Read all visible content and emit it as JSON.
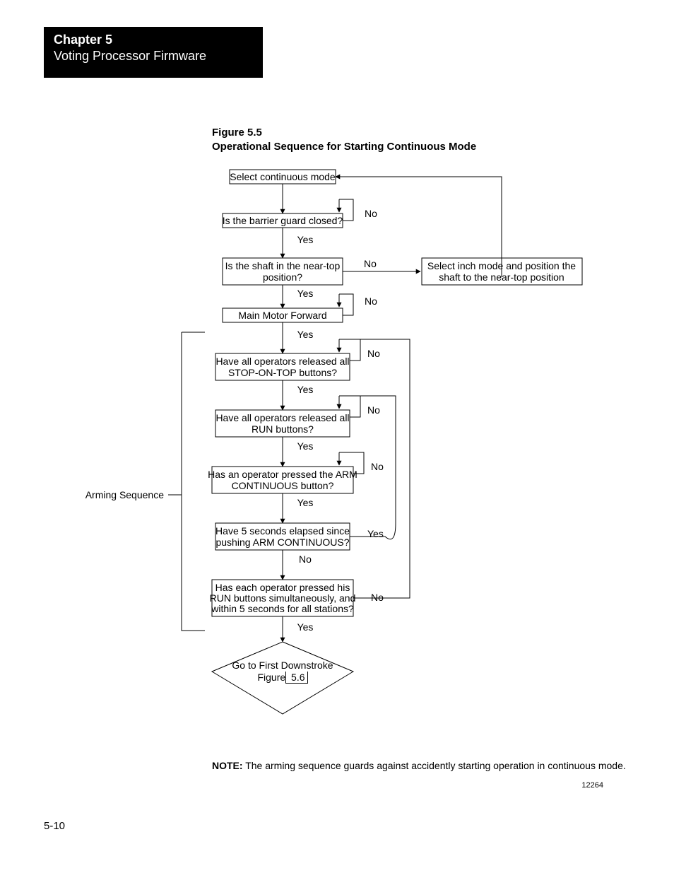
{
  "header": {
    "chapter": "Chapter 5",
    "subtitle": "Voting Processor Firmware"
  },
  "figure": {
    "label": "Figure 5.5",
    "title": "Operational Sequence for Starting Continuous Mode"
  },
  "labels": {
    "yes": "Yes",
    "no": "No",
    "arming_sequence": "Arming Sequence"
  },
  "nodes": {
    "start": "Select continuous mode",
    "barrier": "Is the barrier guard closed?",
    "near_top_1": "Is the shaft in the near-top",
    "near_top_2": "position?",
    "inch_1": "Select inch mode and position the",
    "inch_2": "shaft to the near-top position",
    "motor": "Main Motor Forward",
    "stop_on_top_1": "Have all operators released all",
    "stop_on_top_2": "STOP-ON-TOP buttons?",
    "run_rel_1": "Have all operators released all",
    "run_rel_2": "RUN buttons?",
    "arm_1": "Has an operator pressed the ARM",
    "arm_2": "CONTINUOUS button?",
    "five_sec_1": "Have 5 seconds elapsed since",
    "five_sec_2": "pushing ARM CONTINUOUS?",
    "each_run_1": "Has each operator pressed his",
    "each_run_2": "RUN buttons simultaneously, and",
    "each_run_3": "within 5 seconds for all stations?",
    "goto_1": "Go to First Downstroke",
    "goto_2a": "Figure",
    "goto_2b": " 5.6 "
  },
  "note": {
    "label": "NOTE:",
    "text": " The arming sequence guards against accidently starting operation in continuous mode."
  },
  "doc_id": "12264",
  "page_number": "5-10"
}
